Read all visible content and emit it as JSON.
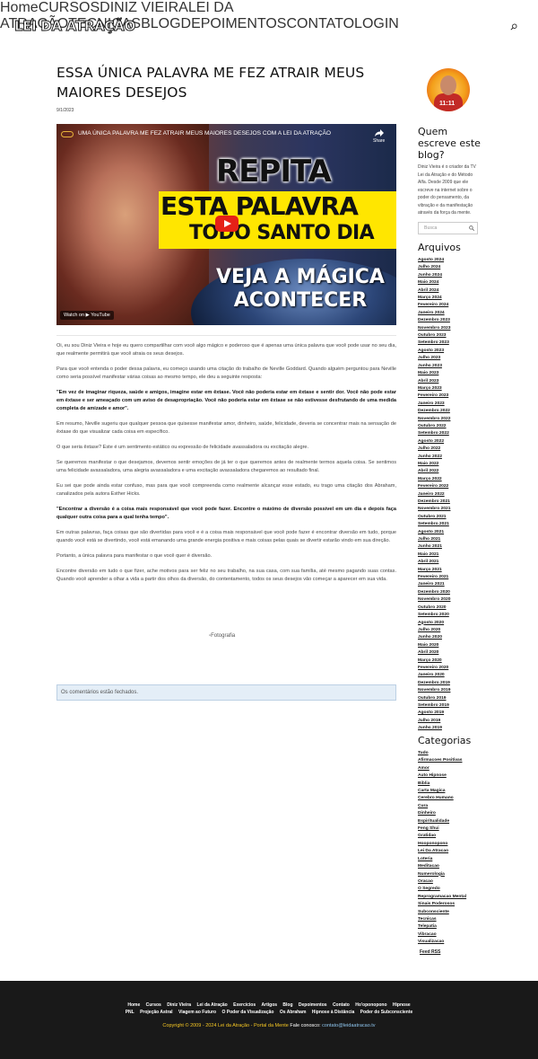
{
  "header": {
    "logo": "LEI DA ATRAÇÃO",
    "nav": [
      "Home",
      "CURSOS",
      "DINIZ VIEIRA",
      "LEI DA ATRAÇÃO",
      "TECNICAS",
      "BLOG",
      "DEPOIMENTOS",
      "CONTATO",
      "LOGIN"
    ]
  },
  "post": {
    "title": "ESSA ÚNICA PALAVRA ME FEZ ATRAIR MEUS MAIORES DESEJOS",
    "date": "9/1/2023",
    "video": {
      "title": "UMA ÚNICA PALAVRA ME FEZ ATRAIR MEUS MAIORES DESEJOS COM A LEI DA ATRAÇÃO",
      "share": "Share",
      "line1": "REPITA",
      "line2": "ESTA PALAVRA",
      "line3": "TODO SANTO DIA",
      "line4": "VEJA A MÁGICA ACONTECER",
      "watch": "Watch on ▶ YouTube"
    },
    "paragraphs": [
      {
        "text": "Oi, eu sou Diniz Vieira e hoje eu quero compartilhar com você algo mágico e poderoso que é apenas uma única palavra que você pode usar no seu dia, que realmente permitirá que você atraia os seus desejos.",
        "bold": false
      },
      {
        "text": "Para que você entenda o poder dessa palavra, eu começo usando uma citação do trabalho de Neville Goddard. Quando alguém perguntou para Neville como seria possível manifestar várias coisas ao mesmo tempo, ele deu a seguinte resposta:",
        "bold": false
      },
      {
        "text": "\"Em vez de imaginar riqueza, saúde e amigos, imagine estar em êxtase. Você não poderia estar em êxtase e sentir dor. Você não pode estar em êxtase e ser ameaçado com um aviso de desapropriação. Você não poderia estar em êxtase se não estivesse desfrutando de uma medida completa de amizade e amor\".",
        "bold": true
      },
      {
        "text": "Em resumo, Neville sugeriu que qualquer pessoa que quisesse manifestar amor, dinheiro, saúde, felicidade, deveria se concentrar mais na sensação de êxtase do que visualizar cada coisa em específico.",
        "bold": false
      },
      {
        "text": "O que seria êxtase? Este é um sentimento estático ou expressão de felicidade avassaladora ou excitação alegre.",
        "bold": false
      },
      {
        "text": "Se queremos manifestar o que desejamos, devemos sentir emoções de já ter o que queremos antes de realmente termos aquela coisa. Se sentimos uma felicidade avassaladora, uma alegria avassaladora e uma excitação avassaladora chegaremos ao resultado final.",
        "bold": false
      },
      {
        "text": "Eu sei que pode ainda estar confuso, mas para que você compreenda como realmente alcançar esse estado, eu trago uma citação dos Abraham, canalizados pela autora Esther Hicks.",
        "bold": false
      },
      {
        "text": "\"Encontrar a diversão é a coisa mais responsável que você pode fazer. Encontre o máximo de diversão possível em um dia e depois faça qualquer outra coisa para a qual tenha tempo\".",
        "bold": true
      },
      {
        "text": "Em outras palavras, faça coisas que são divertidas para você e é a coisa mais responsável que você pode fazer é encontrar diversão em tudo, porque quando você está se divertindo, você está emanando uma grande energia positiva e mais coisas pelas quais se divertir estarão vindo em sua direção.",
        "bold": false
      },
      {
        "text": "Portanto, a única palavra para manifestar o que você quer é diversão.",
        "bold": false
      },
      {
        "text": "Encontre diversão em tudo o que fizer, ache motivos para ser feliz no seu trabalho, na sua casa, com sua família, até mesmo pagando suas contas. Quando você aprender a olhar a vida a partir dos olhos da diversão, do contentamento, todos os seus desejos vão começar a aparecer em sua vida.",
        "bold": false
      }
    ],
    "image_alt": "Fotografia",
    "comments_closed": "Os comentários estão fechados."
  },
  "sidebar": {
    "avatar_number": "11:11",
    "who_title": "Quem escreve este blog?",
    "bio": "Diniz Vieira é o criador da TV Lei da Atração e do Método Alfa. Desde 2009 que ele escreve na internet sobre o poder do pensamento, da vibração e da manifestação através da força da mente.",
    "search_placeholder": "Busca",
    "archives_title": "Arquivos",
    "archives": [
      "Agosto 2024",
      "Julho 2024",
      "Junho 2024",
      "Maio 2024",
      "Abril 2024",
      "Março 2024",
      "Fevereiro 2024",
      "Janeiro 2024",
      "Dezembro 2023",
      "Novembro 2023",
      "Outubro 2023",
      "Setembro 2023",
      "Agosto 2023",
      "Julho 2023",
      "Junho 2023",
      "Maio 2023",
      "Abril 2023",
      "Março 2023",
      "Fevereiro 2023",
      "Janeiro 2023",
      "Dezembro 2022",
      "Novembro 2022",
      "Outubro 2022",
      "Setembro 2022",
      "Agosto 2022",
      "Julho 2022",
      "Junho 2022",
      "Maio 2022",
      "Abril 2022",
      "Março 2022",
      "Fevereiro 2022",
      "Janeiro 2022",
      "Dezembro 2021",
      "Novembro 2021",
      "Outubro 2021",
      "Setembro 2021",
      "Agosto 2021",
      "Julho 2021",
      "Junho 2021",
      "Maio 2021",
      "Abril 2021",
      "Março 2021",
      "Fevereiro 2021",
      "Janeiro 2021",
      "Dezembro 2020",
      "Novembro 2020",
      "Outubro 2020",
      "Setembro 2020",
      "Agosto 2020",
      "Julho 2020",
      "Junho 2020",
      "Maio 2020",
      "Abril 2020",
      "Março 2020",
      "Fevereiro 2020",
      "Janeiro 2020",
      "Dezembro 2019",
      "Novembro 2019",
      "Outubro 2019",
      "Setembro 2019",
      "Agosto 2019",
      "Julho 2019",
      "Junho 2019"
    ],
    "categories_title": "Categorias",
    "categories": [
      "Tudo",
      "Afirmacoes Positivas",
      "Amor",
      "Auto Hipnose",
      "Biblia",
      "Carta Magica",
      "Cerebro Humano",
      "Cura",
      "Dinheiro",
      "Espiritualidade",
      "Feng Shui",
      "Gratidao",
      "Hooponopono",
      "Lei Da Atracao",
      "Loteria",
      "Meditacao",
      "Numerologia",
      "Oracao",
      "O Segredo",
      "Reprogramacao Mental",
      "Sinais Poderosos",
      "Subconsciente",
      "Tecnicas",
      "Telepatia",
      "Vibracao",
      "Visualizacao"
    ],
    "feed": "Feed RSS"
  },
  "footer": {
    "row1": [
      "Home",
      "Cursos",
      "Diniz Vieira",
      "Lei da Atração",
      "Exercícios",
      "Artigos",
      "Blog",
      "Depoimentos",
      "Contato",
      "Ho'oponopono",
      "Hipnose"
    ],
    "row2": [
      "PNL",
      "Projeção Astral",
      "Viagem ao Futuro",
      "O Poder da Visualização",
      "Os Abraham",
      "Hipnose à Distância",
      "Poder do Subconsciente"
    ],
    "copyright": "Copyright © 2009 - 2024 Lei da Atração - Portal da Mente",
    "contact_label": "Fale conosco:",
    "email": "contato@leidaatracao.tv"
  },
  "icons": {
    "search": "search-icon",
    "play": "play-icon",
    "share": "share-icon"
  }
}
